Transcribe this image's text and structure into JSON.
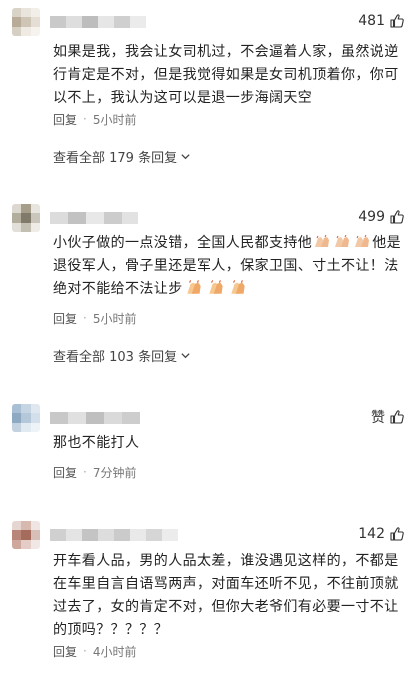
{
  "comments": [
    {
      "likes": "481",
      "text": "如果是我，我会让女司机过，不会逼着人家，虽然说逆行肯定是不对，但是我觉得如果是女司机顶着你，你可以不上，我认为这可以是退一步海阔天空",
      "reply_label": "回复",
      "time": "5小时前",
      "view_all": "查看全部 179 条回复"
    },
    {
      "likes": "499",
      "text_a": "小伙子做的一点没错，全国人民都支持他",
      "text_b": "他是退役军人，骨子里还是军人，保家卫国、寸土不让！法绝对不能给不法让步",
      "reply_label": "回复",
      "time": "5小时前",
      "view_all": "查看全部 103 条回复",
      "emoji": "clapping-hands"
    },
    {
      "likes": "赞",
      "text": "那也不能打人",
      "reply_label": "回复",
      "time": "7分钟前"
    },
    {
      "likes": "142",
      "text": "开车看人品，男的人品太差，谁没遇见这样的，不都是在车里自言自语骂两声，对面车还听不见，不往前顶就过去了，女的肯定不对，但你大老爷们有必要一寸不让的顶吗？？？？？",
      "reply_label": "回复",
      "time": "4小时前"
    }
  ],
  "colors": {
    "text": "#222222",
    "meta": "#777777",
    "background": "#ffffff"
  },
  "icons": {
    "like": "thumbs-up-icon",
    "expand": "chevron-down-icon",
    "emoji": "clapping-hands-emoji"
  }
}
